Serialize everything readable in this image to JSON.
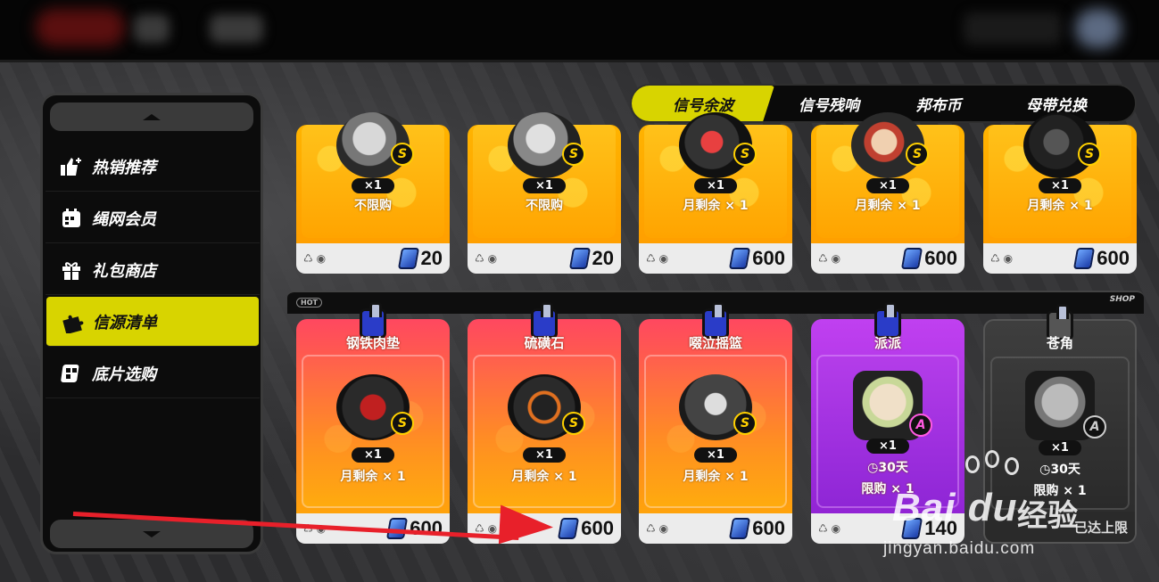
{
  "sidebar": {
    "items": [
      {
        "label": "热销推荐",
        "icon": "thumbs-up-icon"
      },
      {
        "label": "绳网会员",
        "icon": "calendar-icon"
      },
      {
        "label": "礼包商店",
        "icon": "gift-icon"
      },
      {
        "label": "信源清单",
        "icon": "puzzle-icon",
        "active": true
      },
      {
        "label": "底片选购",
        "icon": "film-icon"
      }
    ]
  },
  "tabs": [
    {
      "label": "信号余波",
      "active": true
    },
    {
      "label": "信号残响"
    },
    {
      "label": "邦布币"
    },
    {
      "label": "母带兑换"
    }
  ],
  "top_row": [
    {
      "qty": "×1",
      "limit": "不限购",
      "price": "20",
      "rank": "S"
    },
    {
      "qty": "×1",
      "limit": "不限购",
      "price": "20",
      "rank": "S"
    },
    {
      "qty": "×1",
      "limit": "月剩余 × 1",
      "price": "600",
      "rank": "S"
    },
    {
      "qty": "×1",
      "limit": "月剩余 × 1",
      "price": "600",
      "rank": "S"
    },
    {
      "qty": "×1",
      "limit": "月剩余 × 1",
      "price": "600",
      "rank": "S"
    }
  ],
  "shelf": {
    "hot": "HOT",
    "shop": "SHOP"
  },
  "bottom_row": [
    {
      "name": "钢铁肉垫",
      "qty": "×1",
      "limit": "月剩余 × 1",
      "price": "600",
      "rank": "S"
    },
    {
      "name": "硫磺石",
      "qty": "×1",
      "limit": "月剩余 × 1",
      "price": "600",
      "rank": "S"
    },
    {
      "name": "啜泣摇篮",
      "qty": "×1",
      "limit": "月剩余 × 1",
      "price": "600",
      "rank": "S"
    },
    {
      "name": "派派",
      "qty": "×1",
      "duration": "30天",
      "limit": "限购 × 1",
      "price": "140",
      "rank": "A"
    },
    {
      "name": "苍角",
      "qty": "×1",
      "duration": "30天",
      "limit": "限购 × 1",
      "status": "已达上限",
      "rank": "A"
    }
  ],
  "watermark": {
    "logo": "Bai du",
    "cn": "经验",
    "url": "jingyan.baidu.com"
  }
}
